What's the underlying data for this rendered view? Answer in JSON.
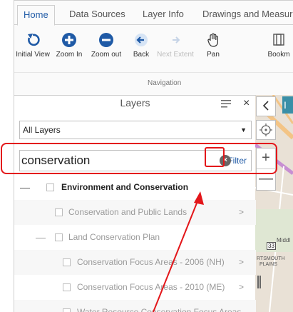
{
  "ribbon": {
    "tabs": [
      {
        "label": "Home"
      },
      {
        "label": "Data Sources"
      },
      {
        "label": "Layer Info"
      },
      {
        "label": "Drawings and Measure"
      }
    ],
    "tools": [
      {
        "label": "Initial View"
      },
      {
        "label": "Zoom In"
      },
      {
        "label": "Zoom out"
      },
      {
        "label": "Back"
      },
      {
        "label": "Next Extent"
      },
      {
        "label": "Pan"
      },
      {
        "label": "Bookm"
      }
    ],
    "group_label": "Navigation"
  },
  "layers_panel": {
    "title": "Layers",
    "select_value": "All Layers",
    "search_value": "conservation",
    "filter_label": "Filter",
    "rows": [
      {
        "label": "Environment and Conservation"
      },
      {
        "label": "Conservation and Public Lands"
      },
      {
        "label": "Land Conservation Plan"
      },
      {
        "label": "Conservation Focus Areas - 2006 (NH)"
      },
      {
        "label": "Conservation Focus Areas - 2010 (ME)"
      },
      {
        "label": "Water Resource Conservation Focus Areas"
      }
    ]
  },
  "map": {
    "road_labels": [
      "Middl",
      "33",
      "RTSMOUTH",
      "PLAINS"
    ],
    "chip_label": "I"
  },
  "colors": {
    "accent": "#1f5aa6",
    "annotation": "#e3161a",
    "map_bg": "#e6ddd2",
    "chip": "#3a8fa7"
  }
}
